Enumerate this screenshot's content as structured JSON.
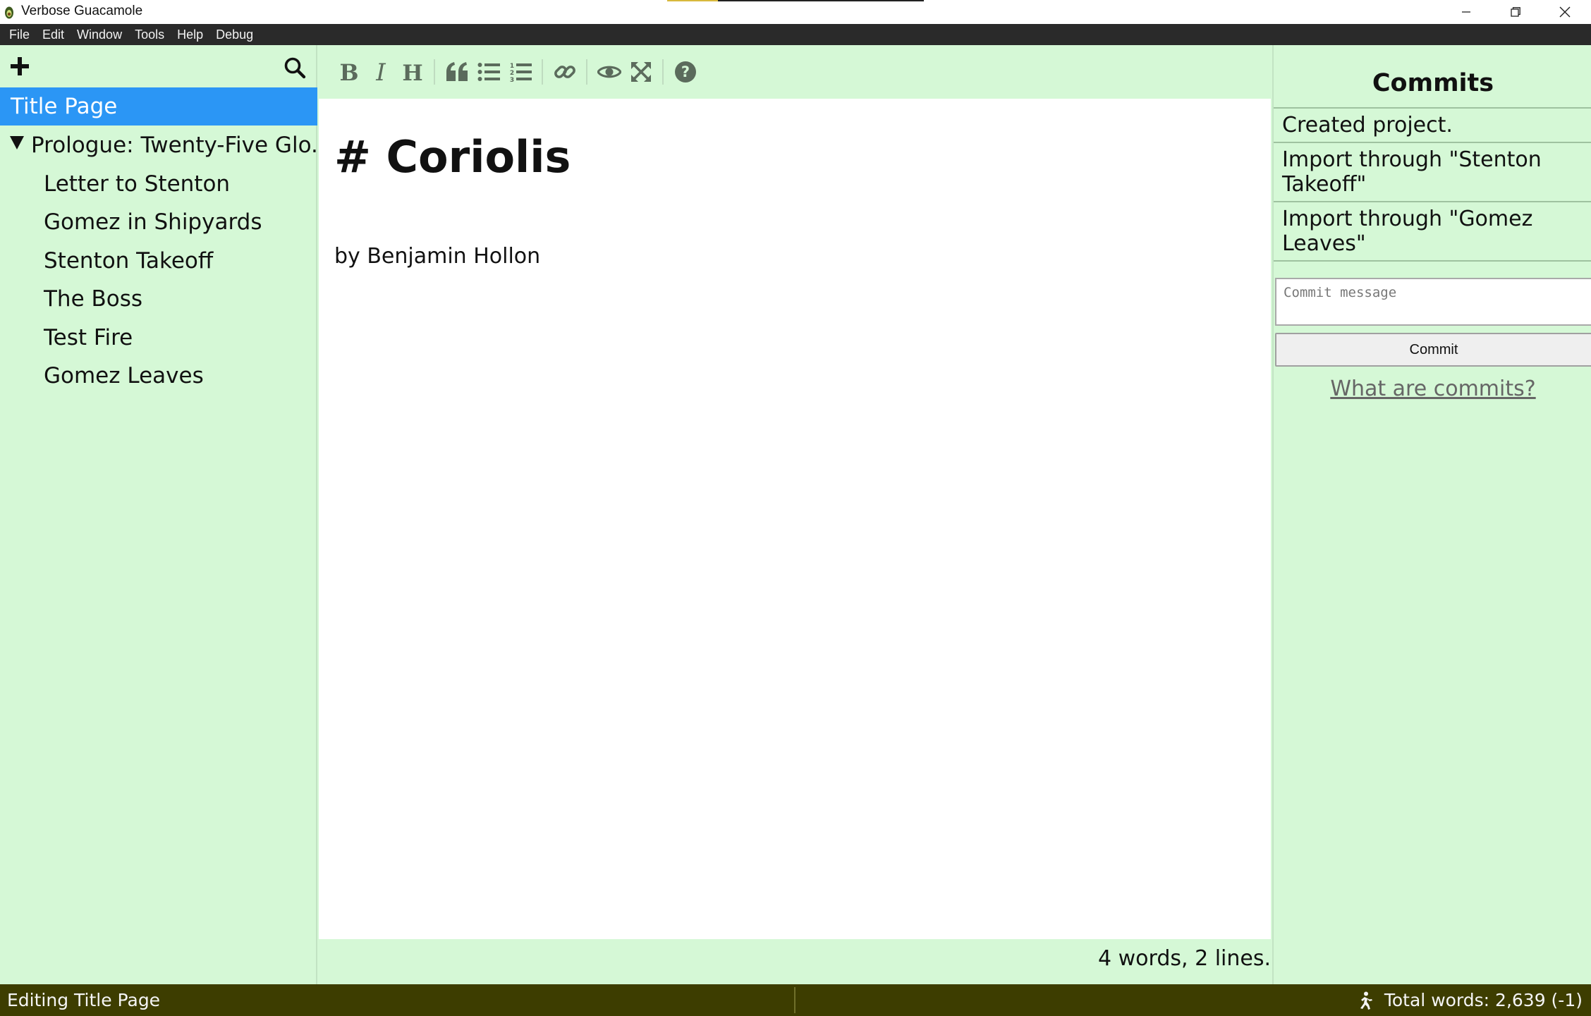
{
  "window": {
    "title": "Verbose Guacamole",
    "controls": {
      "minimize": "minimize-icon",
      "restore": "restore-icon",
      "close": "close-icon"
    }
  },
  "menu": [
    "File",
    "Edit",
    "Window",
    "Tools",
    "Help",
    "Debug"
  ],
  "sidebar": {
    "add_icon": "plus-icon",
    "search_icon": "search-icon",
    "selected": "Title Page",
    "items": [
      {
        "label": "Title Page"
      },
      {
        "label": "Prologue: Twenty-Five Glo...",
        "expanded": true
      }
    ],
    "chapters": [
      "Letter to Stenton",
      "Gomez in Shipyards",
      "Stenton Takeoff",
      "The Boss",
      "Test Fire",
      "Gomez Leaves"
    ]
  },
  "toolbar": {
    "icons": [
      "bold-icon",
      "italic-icon",
      "heading-icon",
      "quote-icon",
      "unordered-list-icon",
      "ordered-list-icon",
      "link-icon",
      "preview-icon",
      "fullscreen-icon",
      "help-icon"
    ]
  },
  "editor": {
    "heading": "# Coriolis",
    "byline": "by Benjamin Hollon",
    "wordcount": "4 words, 2 lines."
  },
  "commits": {
    "title": "Commits",
    "items": [
      "Created project.",
      "Import through \"Stenton Takeoff\"",
      "Import through \"Gomez Leaves\""
    ],
    "message_placeholder": "Commit message",
    "message_value": "",
    "commit_label": "Commit",
    "help_link": "What are commits?"
  },
  "status": {
    "left": "Editing Title Page",
    "right": "Total words: 2,639 (-1)",
    "icon": "running-person-icon"
  },
  "colors": {
    "background": "#d5f8d6",
    "selected": "#2b96f5",
    "statusbar": "#3d3d00",
    "menubar": "#2a2a2a",
    "toolbar_icon": "#5b6b5c"
  }
}
